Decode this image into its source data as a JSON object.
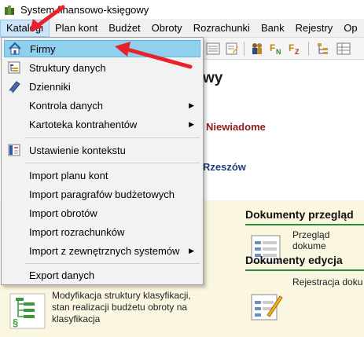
{
  "window": {
    "title": "System finansowo-księgowy"
  },
  "menubar": {
    "items": [
      "Katalogi",
      "Plan kont",
      "Budżet",
      "Obroty",
      "Rozrachunki",
      "Bank",
      "Rejestry",
      "Op"
    ]
  },
  "main": {
    "heading_fragment": "wy",
    "red_label": "Niewiadome",
    "blue_label": "Rzeszów",
    "sections": [
      {
        "title": "Dokumenty przegląd",
        "description": "Przegląd dokume"
      },
      {
        "title": "Dokumenty edycja",
        "description": "Rejestracja doku"
      }
    ],
    "bottom_description": "Modyfikacja struktury klasyfikacji, stan realizacji budżetu obroty na klasyfikacja"
  },
  "dropdown": {
    "items": [
      {
        "label": "Firmy",
        "icon": "house-icon",
        "highlighted": true
      },
      {
        "label": "Struktury danych",
        "icon": "structure-icon"
      },
      {
        "label": "Dzienniki",
        "icon": "book-icon"
      },
      {
        "label": "Kontrola danych",
        "submenu": true
      },
      {
        "label": "Kartoteka kontrahentów",
        "submenu": true
      },
      {
        "label": "Ustawienie kontekstu",
        "icon": "context-icon"
      },
      {
        "label": "Import planu kont"
      },
      {
        "label": "Import paragrafów budżetowych"
      },
      {
        "label": "Import obrotów"
      },
      {
        "label": "Import rozrachunków"
      },
      {
        "label": "Import z zewnętrznych systemów",
        "submenu": true
      },
      {
        "label": "Export danych"
      }
    ]
  },
  "colors": {
    "highlight": "#8fd0ee",
    "annotation_arrow": "#e8212a",
    "section_underline": "#2b8a3e",
    "red_label": "#8b1d1d",
    "blue_label": "#1f3f7a"
  }
}
